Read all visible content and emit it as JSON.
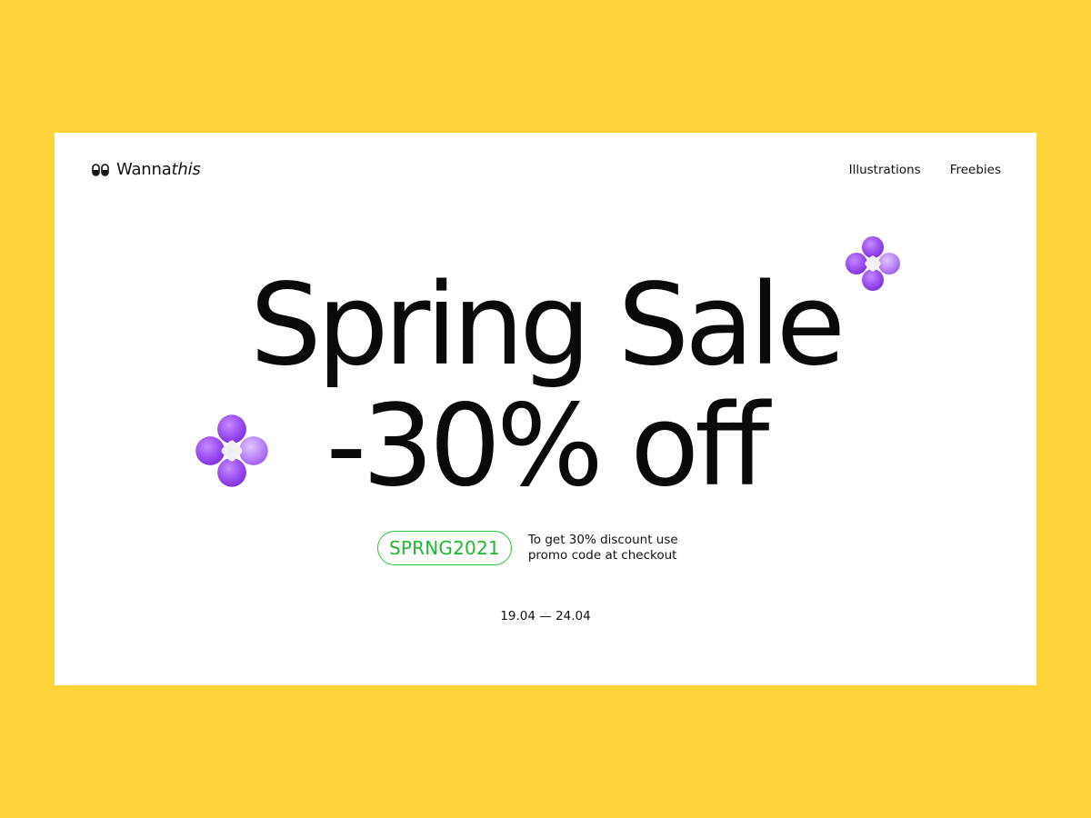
{
  "brand": {
    "name_regular": "Wanna",
    "name_italic": "this",
    "background_color": "#FED339"
  },
  "nav": {
    "items": [
      {
        "label": "Illustrations"
      },
      {
        "label": "Freebies"
      }
    ]
  },
  "hero": {
    "line1": "Spring Sale",
    "line2": "-30% off"
  },
  "promo": {
    "code": "SPRNG2021",
    "note_line1": "To get 30% discount use",
    "note_line2": "promo code at checkout",
    "accent_color": "#20B830"
  },
  "dates": "19.04 — 24.04",
  "icons": {
    "logo": "pill-pair-icon",
    "decor": "flower-icon",
    "flower_color": "#9B4DF0"
  }
}
